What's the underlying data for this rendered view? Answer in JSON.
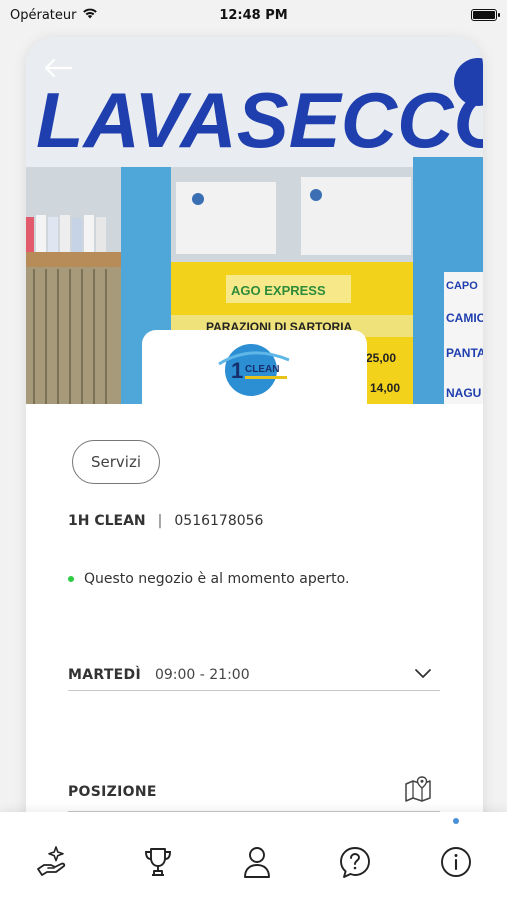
{
  "status_bar": {
    "carrier": "Opérateur",
    "time": "12:48 PM"
  },
  "hero": {
    "sign_text": "LAVASECCO",
    "logo_text": "CLEAN",
    "photo_banner": "AGO EXPRESS",
    "photo_strip": "PARAZIONI DI SARTORIA",
    "photo_side": [
      "CAPO",
      "CAMIC",
      "PANTA",
      "NAGU"
    ],
    "photo_prices": [
      "25,00",
      "14,00"
    ]
  },
  "store": {
    "services_chip": "Servizi",
    "name": "1H CLEAN",
    "separator": "|",
    "phone": "0516178056",
    "open_status": "Questo negozio è al momento aperto.",
    "open_color": "#2ecc40",
    "hours": {
      "day": "MARTEDÌ",
      "time": "09:00 - 21:00"
    },
    "position_label": "POSIZIONE"
  },
  "tabbar": {
    "tabs": [
      {
        "icon": "hand-sparkle-icon"
      },
      {
        "icon": "trophy-icon"
      },
      {
        "icon": "user-icon"
      },
      {
        "icon": "help-icon"
      },
      {
        "icon": "info-icon"
      }
    ],
    "active_indicator_color": "#4a90d9"
  }
}
